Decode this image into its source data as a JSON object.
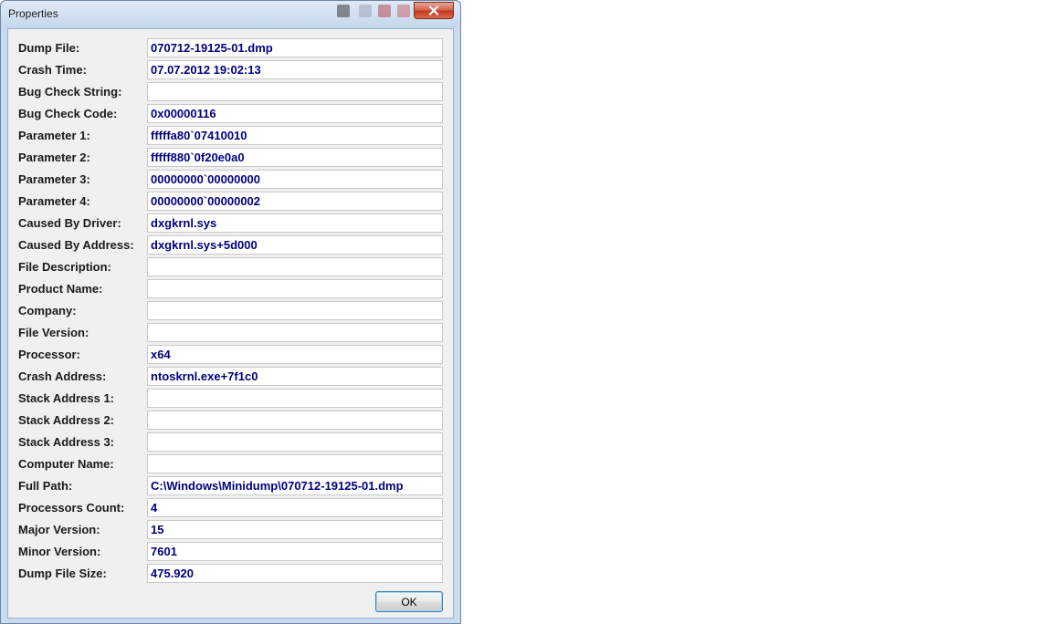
{
  "window": {
    "title": "Properties",
    "close_icon": "close-icon"
  },
  "properties": [
    {
      "label": "Dump File:",
      "value": "070712-19125-01.dmp"
    },
    {
      "label": "Crash Time:",
      "value": "07.07.2012 19:02:13"
    },
    {
      "label": "Bug Check String:",
      "value": ""
    },
    {
      "label": "Bug Check Code:",
      "value": "0x00000116"
    },
    {
      "label": "Parameter 1:",
      "value": "fffffa80`07410010"
    },
    {
      "label": "Parameter 2:",
      "value": "fffff880`0f20e0a0"
    },
    {
      "label": "Parameter 3:",
      "value": "00000000`00000000"
    },
    {
      "label": "Parameter 4:",
      "value": "00000000`00000002"
    },
    {
      "label": "Caused By Driver:",
      "value": "dxgkrnl.sys"
    },
    {
      "label": "Caused By Address:",
      "value": "dxgkrnl.sys+5d000"
    },
    {
      "label": "File Description:",
      "value": ""
    },
    {
      "label": "Product Name:",
      "value": ""
    },
    {
      "label": "Company:",
      "value": ""
    },
    {
      "label": "File Version:",
      "value": ""
    },
    {
      "label": "Processor:",
      "value": "x64"
    },
    {
      "label": "Crash Address:",
      "value": "ntoskrnl.exe+7f1c0"
    },
    {
      "label": "Stack Address 1:",
      "value": ""
    },
    {
      "label": "Stack Address 2:",
      "value": ""
    },
    {
      "label": "Stack Address 3:",
      "value": ""
    },
    {
      "label": "Computer Name:",
      "value": ""
    },
    {
      "label": "Full Path:",
      "value": "C:\\Windows\\Minidump\\070712-19125-01.dmp"
    },
    {
      "label": "Processors Count:",
      "value": "4"
    },
    {
      "label": "Major Version:",
      "value": "15"
    },
    {
      "label": "Minor Version:",
      "value": "7601"
    },
    {
      "label": "Dump File Size:",
      "value": "475.920"
    }
  ],
  "buttons": {
    "ok_label": "OK"
  },
  "colors": {
    "value_text": "#00007f",
    "label_text": "#1a1a1a",
    "dialog_bg": "#f0f0f0",
    "frame": "#c9dcef",
    "close_button": "#c2391f"
  }
}
